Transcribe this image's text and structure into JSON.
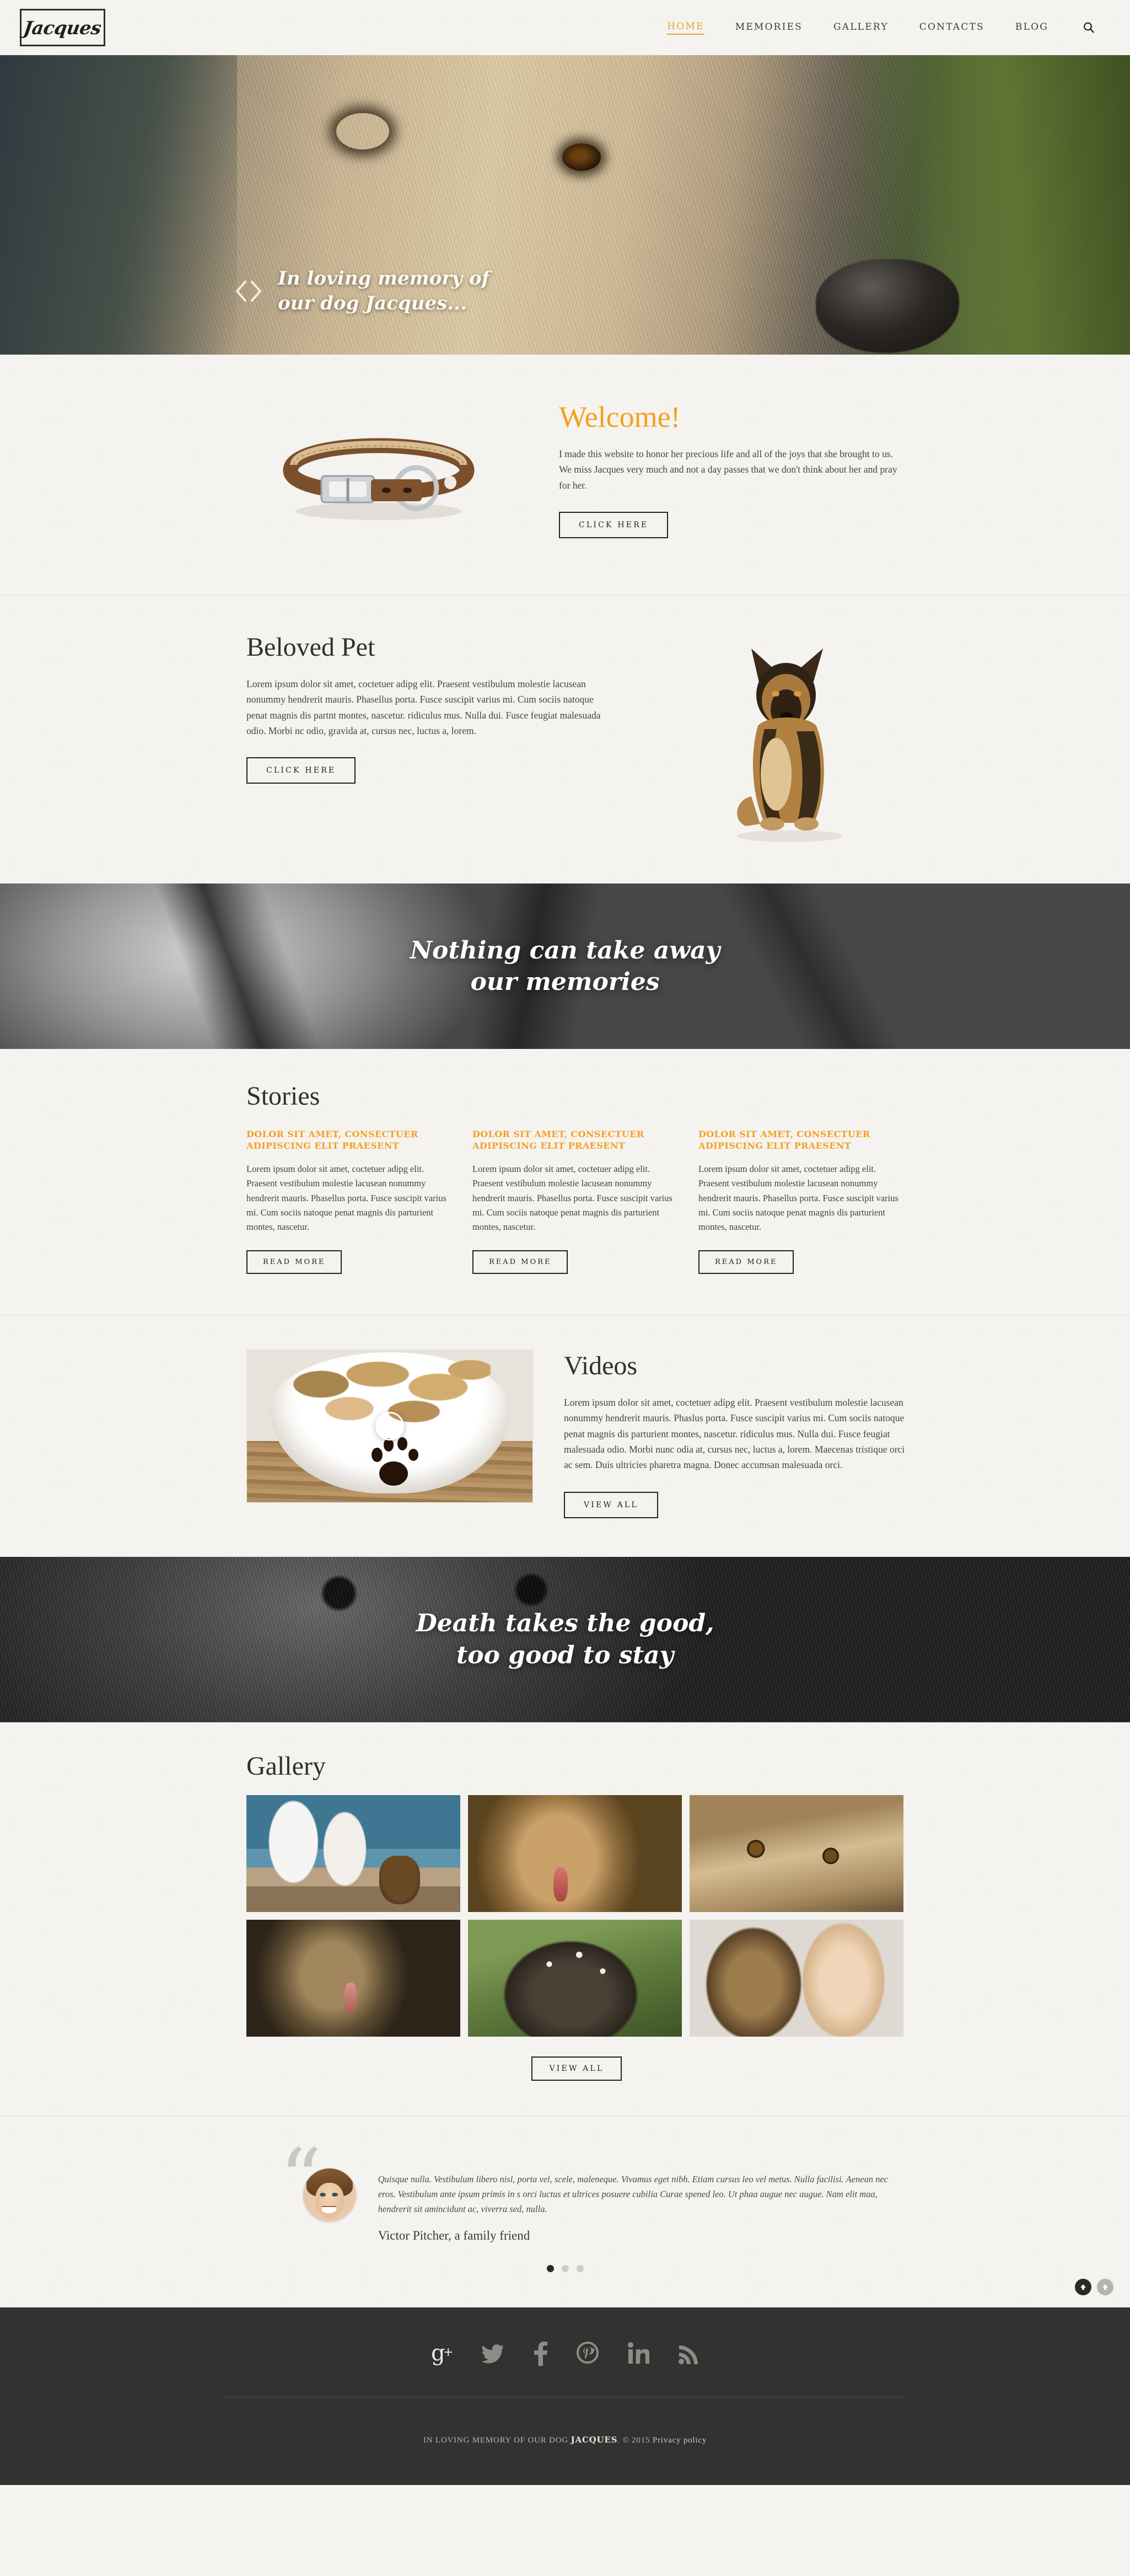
{
  "header": {
    "logo_text": "Jacques",
    "nav": [
      {
        "label": "HOME",
        "active": true
      },
      {
        "label": "MEMORIES",
        "active": false
      },
      {
        "label": "GALLERY",
        "active": false
      },
      {
        "label": "CONTACTS",
        "active": false
      },
      {
        "label": "BLOG",
        "active": false
      }
    ],
    "search_icon": "search-icon"
  },
  "hero": {
    "caption": "In loving memory of\nour dog Jacques...",
    "nav_icon": "diamond-slider-icon"
  },
  "welcome": {
    "title": "Welcome!",
    "text": "I made this website to honor her precious life and all of the joys that she brought to us. We miss Jacques very much and not a day passes that we don't think about her and pray for her.",
    "button": "CLICK HERE",
    "image_alt": "brown-leather-dog-collar"
  },
  "beloved": {
    "title": "Beloved Pet",
    "text": "Lorem ipsum dolor sit amet, coctetuer adipg elit. Praesent vestibulum molestie lacusean nonummy hendrerit mauris. Phasellus porta. Fusce suscipit varius mi. Cum sociis natoque penat magnis dis partnt montes, nascetur. ridiculus mus. Nulla dui. Fusce feugiat malesuada odio. Morbi nc odio, gravida at, cursus nec, luctus a, lorem.",
    "button": "CLICK HERE",
    "image_alt": "german-shepherd-sitting"
  },
  "quote_one": "Nothing can take away\nour memories",
  "stories": {
    "title": "Stories",
    "items": [
      {
        "title": "DOLOR SIT AMET, CONSECTUER ADIPISCING ELIT PRAESENT",
        "text": "Lorem ipsum dolor sit amet, coctetuer adipg elit. Praesent vestibulum molestie lacusean nonummy hendrerit mauris. Phasellus porta. Fusce suscipit varius mi. Cum sociis natoque penat magnis dis parturient montes, nascetur.",
        "button": "READ MORE"
      },
      {
        "title": "DOLOR SIT AMET, CONSECTUER ADIPISCING ELIT PRAESENT",
        "text": "Lorem ipsum dolor sit amet, coctetuer adipg elit. Praesent vestibulum molestie lacusean nonummy hendrerit mauris. Phasellus porta. Fusce suscipit varius mi. Cum sociis natoque penat magnis dis parturient montes, nascetur.",
        "button": "READ MORE"
      },
      {
        "title": "DOLOR SIT AMET, CONSECTUER ADIPISCING ELIT PRAESENT",
        "text": "Lorem ipsum dolor sit amet, coctetuer adipg elit. Praesent vestibulum molestie lacusean nonummy hendrerit mauris. Phasellus porta. Fusce suscipit varius mi. Cum sociis natoque penat magnis dis parturient montes, nascetur.",
        "button": "READ MORE"
      }
    ]
  },
  "videos": {
    "title": "Videos",
    "text": "Lorem ipsum dolor sit amet, coctetuer adipg elit. Praesent vestibulum molestie lacusean nonummy hendrerit mauris. Phaslus porta. Fusce suscipit varius mi. Cum sociis natoque penat magnis dis parturient montes, nascetur. ridiculus mus. Nulla dui. Fusce feugiat malesuada odio. Morbi nunc odia at, cursus nec, luctus a, lorem. Maecenas tristique orci ac sem. Duis ultricies pharetra magna. Donec accumsan malesuada orci.",
    "button": "VIEW ALL",
    "thumb_alt": "dog-treats-in-paw-print-bowl",
    "play_icon": "play-icon"
  },
  "quote_two": "Death takes the good,\ntoo good to stay",
  "gallery": {
    "title": "Gallery",
    "button": "VIEW ALL",
    "items": [
      {
        "alt": "family-walking-with-dog-on-beach"
      },
      {
        "alt": "german-shepherd-on-sidewalk"
      },
      {
        "alt": "close-up-of-dog-eyes"
      },
      {
        "alt": "german-shepherd-in-grass"
      },
      {
        "alt": "dog-lying-among-flowers"
      },
      {
        "alt": "girl-with-german-shepherd"
      }
    ]
  },
  "testimonial": {
    "quote_mark": "“",
    "text": "Quisque nulla. Vestibulum libero nisl, porta vel, scele, maleneque. Vivamus eget nibh. Etiam cursus leo vel metus. Nulla facilisi. Aenean nec eros. Vestibulum ante ipsum primis in s orci luctus et ultrices posuere cubilia Curae spened leo. Ut phaa augue nec augue. Nam elit maa, hendrerit sit amincidunt ac, viverra sed, nulla.",
    "author": "Victor Pitcher, a family friend",
    "avatar_alt": "victor-pitcher-avatar",
    "dots": [
      {
        "active": true
      },
      {
        "active": false
      },
      {
        "active": false
      }
    ]
  },
  "footer": {
    "social": [
      {
        "name": "google-plus-icon",
        "glyph": "g+"
      },
      {
        "name": "twitter-icon",
        "glyph": "twitter"
      },
      {
        "name": "facebook-icon",
        "glyph": "f"
      },
      {
        "name": "pinterest-icon",
        "glyph": "p"
      },
      {
        "name": "linkedin-icon",
        "glyph": "in"
      },
      {
        "name": "rss-icon",
        "glyph": "rss"
      }
    ],
    "copyright_prefix": "IN LOVING MEMORY OF OUR DOG ",
    "copyright_brand": "JACQUES",
    "copyright_suffix": ". © 2015 ",
    "privacy": "Privacy policy"
  },
  "colors": {
    "accent": "#f5a01e",
    "paper": "#f4f3f0",
    "ink": "#31302e",
    "footer_bg": "#323230"
  }
}
